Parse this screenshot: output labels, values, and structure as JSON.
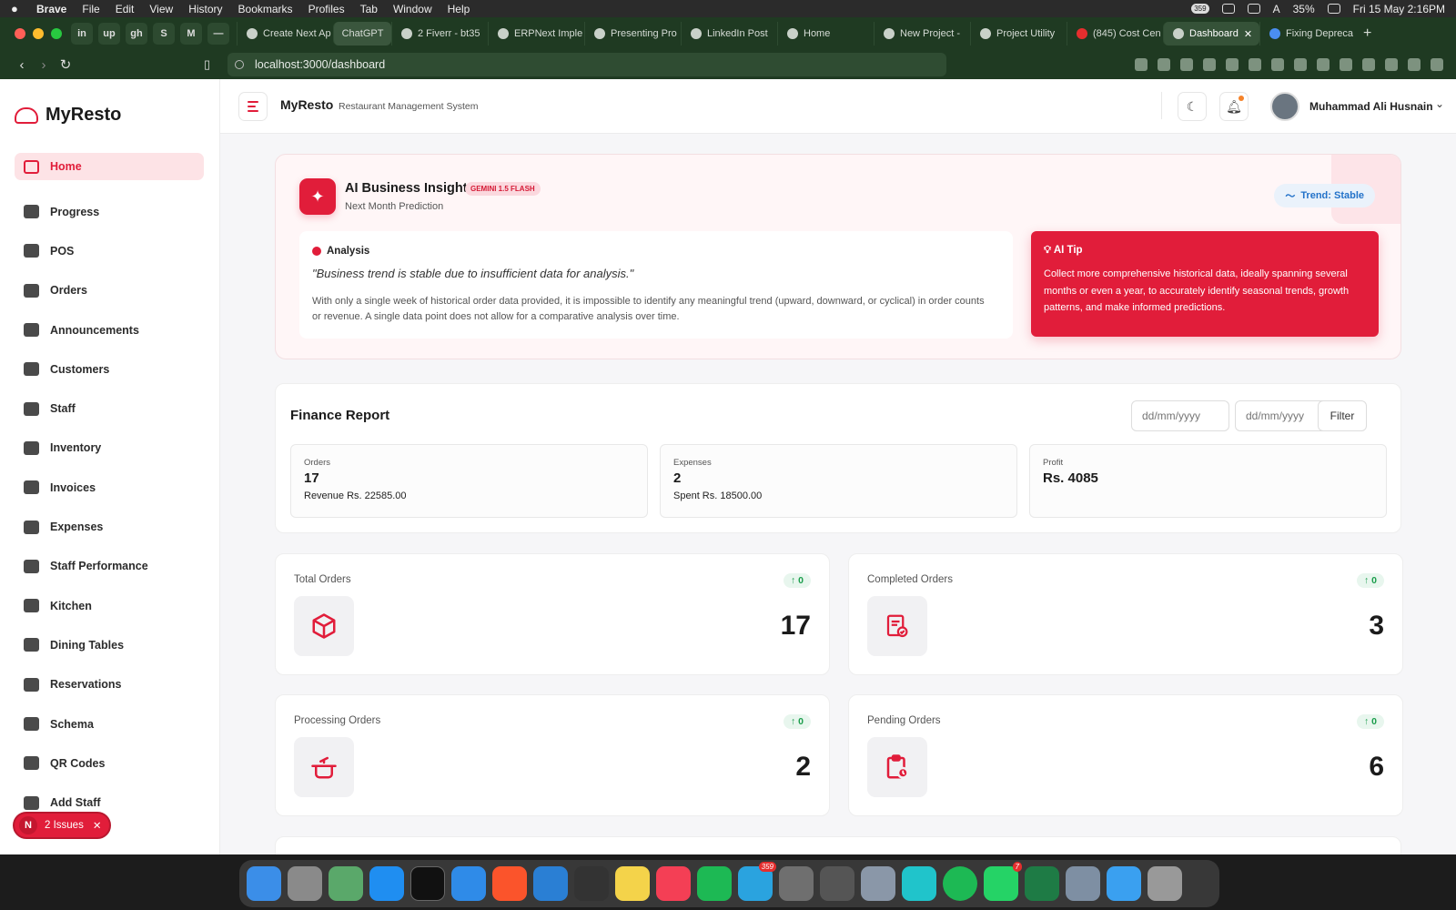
{
  "menubar": {
    "apple": "",
    "app": "Brave",
    "items": [
      "File",
      "Edit",
      "View",
      "History",
      "Bookmarks",
      "Profiles",
      "Tab",
      "Window",
      "Help"
    ],
    "status_badge": "359",
    "input_source": "A",
    "battery": "35%",
    "datetime": "Fri 15 May  2:16PM"
  },
  "browser": {
    "pinned": [
      "in",
      "up",
      "gh",
      "S",
      "M",
      "—"
    ],
    "tabs": [
      {
        "title": "Create Next Ap"
      },
      {
        "title": "ChatGPT"
      },
      {
        "title": "2 Fiverr - bt35"
      },
      {
        "title": "ERPNext Imple"
      },
      {
        "title": "Presenting Pro"
      },
      {
        "title": "LinkedIn Post"
      },
      {
        "title": "Home"
      },
      {
        "title": "New Project -"
      },
      {
        "title": "Project Utility"
      },
      {
        "title": "(845) Cost Cen"
      },
      {
        "title": "Dashboard"
      },
      {
        "title": "Fixing Depreca"
      }
    ],
    "url": "localhost:3000/dashboard"
  },
  "sidebar": {
    "logo": "MyResto",
    "items": [
      {
        "label": "Home",
        "icon": "grid-icon"
      },
      {
        "label": "Progress",
        "icon": "clipboard-icon"
      },
      {
        "label": "POS",
        "icon": "bag-icon"
      },
      {
        "label": "Orders",
        "icon": "list-icon"
      },
      {
        "label": "Announcements",
        "icon": "megaphone-icon"
      },
      {
        "label": "Customers",
        "icon": "contact-icon"
      },
      {
        "label": "Staff",
        "icon": "users-icon"
      },
      {
        "label": "Inventory",
        "icon": "box-icon"
      },
      {
        "label": "Invoices",
        "icon": "file-icon"
      },
      {
        "label": "Expenses",
        "icon": "dollar-icon"
      },
      {
        "label": "Staff Performance",
        "icon": "chart-line-icon"
      },
      {
        "label": "Kitchen",
        "icon": "utensils-icon"
      },
      {
        "label": "Dining Tables",
        "icon": "chair-icon"
      },
      {
        "label": "Reservations",
        "icon": "calendar-icon"
      },
      {
        "label": "Schema",
        "icon": "database-icon"
      },
      {
        "label": "QR Codes",
        "icon": "qr-icon"
      },
      {
        "label": "Add Staff",
        "icon": "user-plus-icon"
      }
    ],
    "issues": {
      "n": "N",
      "label": "2 Issues",
      "close": "✕"
    }
  },
  "header": {
    "title": "MyResto",
    "subtitle": "Restaurant Management System",
    "user": "Muhammad Ali Husnain"
  },
  "ai": {
    "title": "AI Business Insight",
    "badge": "GEMINI 1.5 FLASH",
    "subtitle": "Next Month Prediction",
    "trend": "Trend: Stable",
    "analysis_heading": "Analysis",
    "quote": "\"Business trend is stable due to insufficient data for analysis.\"",
    "analysis_body": "With only a single week of historical order data provided, it is impossible to identify any meaningful trend (upward, downward, or cyclical) in order counts or revenue. A single data point does not allow for a comparative analysis over time.",
    "tip_heading": "AI Tip",
    "tip_body": "Collect more comprehensive historical data, ideally spanning several months or even a year, to accurately identify seasonal trends, growth patterns, and make informed predictions."
  },
  "finance": {
    "title": "Finance Report",
    "date_placeholder_from": "dd/mm/yyyy",
    "date_placeholder_to": "dd/mm/yyyy",
    "filter_label": "Filter",
    "orders": {
      "label": "Orders",
      "value": "17",
      "sub": "Revenue Rs. 22585.00"
    },
    "expenses": {
      "label": "Expenses",
      "value": "2",
      "sub": "Spent Rs. 18500.00"
    },
    "profit": {
      "label": "Profit",
      "value": "Rs. 4085"
    }
  },
  "stats": {
    "total": {
      "label": "Total Orders",
      "change": "↑ 0",
      "value": "17"
    },
    "completed": {
      "label": "Completed Orders",
      "change": "↑ 0",
      "value": "3"
    },
    "processing": {
      "label": "Processing Orders",
      "change": "↑ 0",
      "value": "2"
    },
    "pending": {
      "label": "Pending Orders",
      "change": "↑ 0",
      "value": "6"
    }
  },
  "dock": {
    "telegram_badge": "359",
    "whatsapp_badge": "7"
  },
  "colors": {
    "accent": "#e11d3a",
    "positive": "#1a9d4b",
    "trend": "#2372c9"
  }
}
